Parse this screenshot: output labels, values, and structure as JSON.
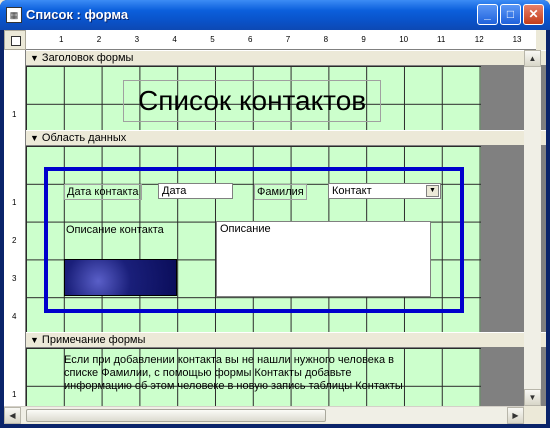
{
  "window": {
    "title": "Список : форма",
    "icon_glyph": "▦",
    "min_glyph": "_",
    "max_glyph": "□",
    "close_glyph": "✕"
  },
  "ruler": {
    "h_labels": [
      "1",
      "2",
      "3",
      "4",
      "5",
      "6",
      "7",
      "8",
      "9",
      "10",
      "11",
      "12",
      "13"
    ],
    "v_labels": [
      "1",
      "1",
      "2",
      "3",
      "4",
      "1"
    ]
  },
  "sections": {
    "header": "Заголовок формы",
    "detail": "Область данных",
    "footer": "Примечание формы"
  },
  "form": {
    "title": "Список контактов",
    "date_label": "Дата контакта",
    "date_field": "Дата",
    "surname_label": "Фамилия",
    "surname_combo": "Контакт",
    "desc_label": "Описание контакта",
    "desc_field": "Описание",
    "footer_note": "Если при добавлении контакта вы не нашли нужного человека в списке Фамилии, с помощью формы Контакты добавьте информацию об этом человеке в новую запись таблицы Контакты"
  },
  "colors": {
    "grid": "#ccffcc",
    "frame": "#0000cc"
  }
}
